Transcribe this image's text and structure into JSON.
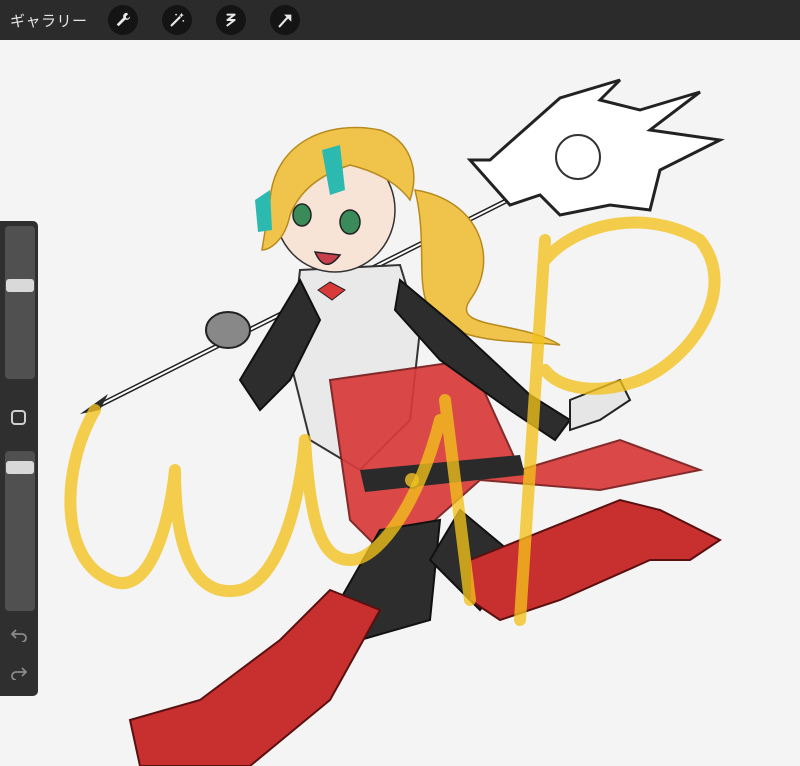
{
  "topbar": {
    "gallery_label": "ギャラリー",
    "tools": [
      {
        "name": "wrench-icon"
      },
      {
        "name": "magic-wand-icon"
      },
      {
        "name": "selection-icon"
      },
      {
        "name": "transform-arrow-icon"
      }
    ]
  },
  "sidebar": {
    "brush_size_level": 0.38,
    "opacity_level": 0.07,
    "modify_icon": "square-icon",
    "undo_icon": "undo-arrow-icon",
    "redo_icon": "redo-arrow-icon"
  },
  "canvas": {
    "watermark_text": "wip",
    "watermark_color": "#f2c21b",
    "colors": {
      "hair": "#f0c44a",
      "accent_teal": "#2bb9b0",
      "armor_red": "#d83a3a",
      "dark": "#2a2a2a"
    }
  },
  "colors": {
    "topbar_bg": "#2b2b2b",
    "canvas_bg": "#f4f4f4",
    "sidebar_bg": "#2f2f2f"
  }
}
